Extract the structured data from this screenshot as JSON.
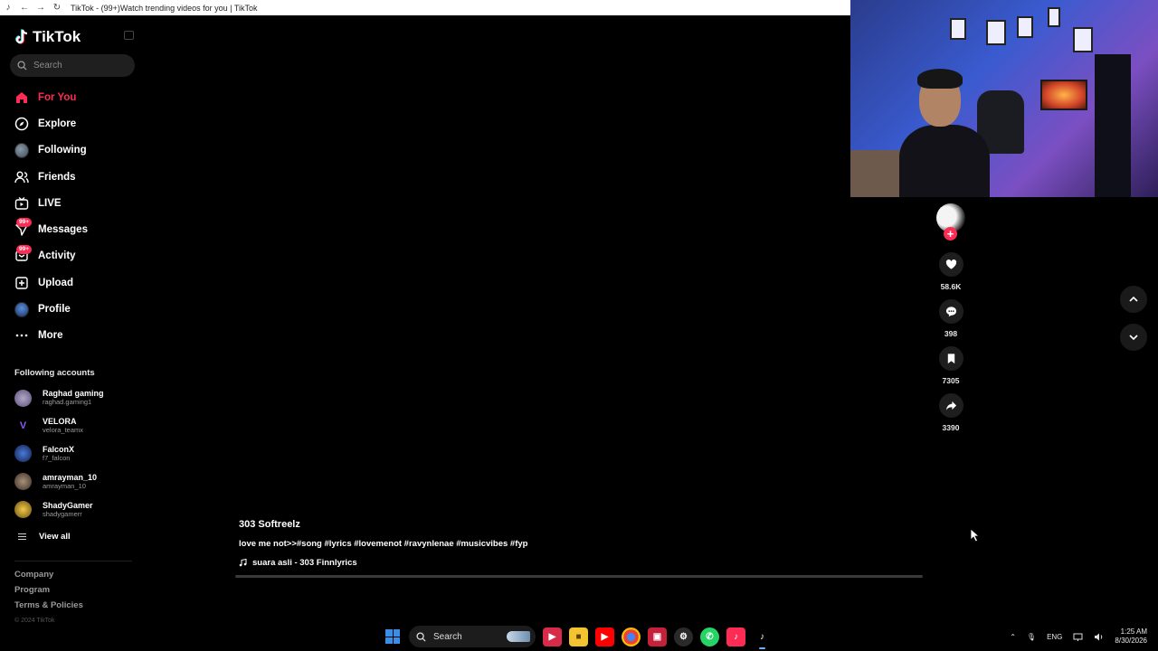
{
  "browser": {
    "tab_title": "TikTok - (99+)Watch trending videos for you | TikTok"
  },
  "sidebar": {
    "logo_text": "TikTok",
    "search_placeholder": "Search",
    "nav": [
      {
        "label": "For You",
        "icon": "home-icon",
        "active": true
      },
      {
        "label": "Explore",
        "icon": "compass-icon",
        "active": false
      },
      {
        "label": "Following",
        "icon": "following-avatar",
        "active": false
      },
      {
        "label": "Friends",
        "icon": "friends-icon",
        "active": false
      },
      {
        "label": "LIVE",
        "icon": "live-tv-icon",
        "active": false
      },
      {
        "label": "Messages",
        "icon": "message-icon",
        "badge": "99+",
        "active": false
      },
      {
        "label": "Activity",
        "icon": "activity-icon",
        "badge": "99+",
        "active": false
      },
      {
        "label": "Upload",
        "icon": "upload-icon",
        "active": false
      },
      {
        "label": "Profile",
        "icon": "profile-avatar",
        "active": false
      },
      {
        "label": "More",
        "icon": "more-icon",
        "active": false
      }
    ],
    "following_title": "Following accounts",
    "accounts": [
      {
        "name": "Raghad gaming",
        "handle": "raghad.gaming1",
        "color": "#8a7fa8"
      },
      {
        "name": "VELORA",
        "handle": "velora_teamx",
        "color": "#3a1a6a"
      },
      {
        "name": "FalconX",
        "handle": "f7_falcon",
        "color": "#1b3a7a"
      },
      {
        "name": "amrayman_10",
        "handle": "amrayman_10",
        "color": "#6a5a4a"
      },
      {
        "name": "ShadyGamer",
        "handle": "shadygamerr",
        "color": "#c9a227"
      }
    ],
    "view_all": "View all",
    "footer": [
      "Company",
      "Program",
      "Terms & Policies"
    ],
    "copyright": "© 2024 TikTok"
  },
  "video": {
    "author": "303 Softreelz",
    "caption": "love me not>>#song #lyrics #lovemenot #ravynlenae #musicvibes #fyp",
    "music": "suara asli - 303 Finnlyrics",
    "progress": 0.0,
    "likes": "58.6K",
    "comments": "398",
    "saves": "7305",
    "shares": "3390"
  },
  "taskbar": {
    "search_label": "Search",
    "lang": "ENG",
    "time": "1:25 AM",
    "date": "8/30/2026"
  },
  "colors": {
    "accent": "#fe2c55",
    "background": "#000000"
  }
}
